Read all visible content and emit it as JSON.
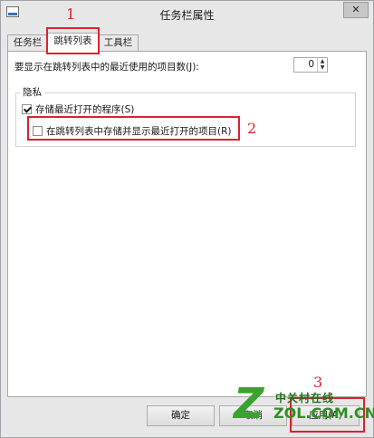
{
  "window": {
    "title": "任务栏属性",
    "close_label": "✕"
  },
  "tabs": [
    {
      "label": "任务栏"
    },
    {
      "label": "跳转列表"
    },
    {
      "label": "工具栏"
    }
  ],
  "jumplist": {
    "recent_count_label": "要显示在跳转列表中的最近使用的项目数(J):",
    "recent_count_value": "0"
  },
  "privacy": {
    "group_label": "隐私",
    "store_programs_label": "存储最近打开的程序(S)",
    "store_programs_checked": true,
    "store_items_label": "在跳转列表中存储并显示最近打开的项目(R)",
    "store_items_checked": false
  },
  "buttons": {
    "ok": "确定",
    "cancel": "取消",
    "apply": "应用(A)"
  },
  "annotations": [
    "1",
    "2",
    "3"
  ],
  "watermark": {
    "mark": "Z",
    "name": "中关村在线",
    "url": "ZOL.COM.CN"
  },
  "colors": {
    "highlight": "#d9232e",
    "watermark": "#3aa32e"
  }
}
